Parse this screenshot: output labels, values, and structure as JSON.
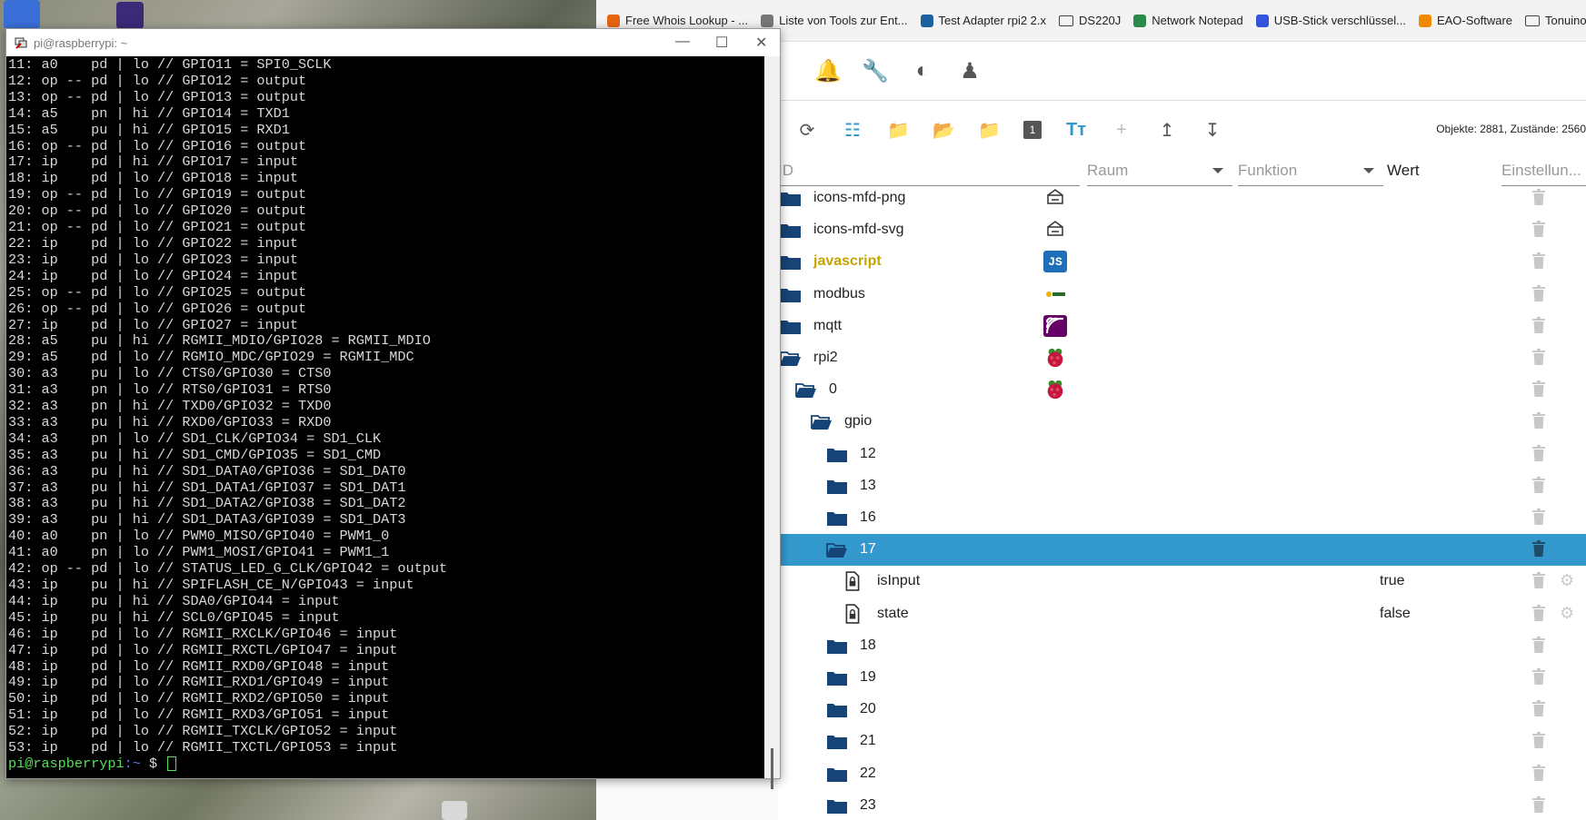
{
  "browser": {
    "bookmarks": [
      {
        "label": "Free Whois Lookup - ...",
        "icon": "orange-logo-icon"
      },
      {
        "label": "Liste von Tools zur Ent...",
        "icon": "globe-icon"
      },
      {
        "label": "Test Adapter rpi2 2.x",
        "icon": "iobroker-icon"
      },
      {
        "label": "DS220J",
        "icon": "folder-icon"
      },
      {
        "label": "Network Notepad",
        "icon": "network-icon"
      },
      {
        "label": "USB-Stick verschlüssel...",
        "icon": "arc-icon"
      },
      {
        "label": "EAO-Software",
        "icon": "star-icon"
      },
      {
        "label": "Tonuino",
        "icon": "folder-icon"
      }
    ]
  },
  "admin": {
    "stats": "Objekte: 2881, Zustände: 2560",
    "columns": {
      "id": "ID",
      "raum": "Raum",
      "funktion": "Funktion",
      "wert": "Wert",
      "einstellung": "Einstellun..."
    },
    "rows": [
      {
        "name": "icons-mfd-png",
        "indent": 0,
        "kind": "folder",
        "open": false,
        "icon": "mfd-png-icon"
      },
      {
        "name": "icons-mfd-svg",
        "indent": 0,
        "kind": "folder",
        "open": false,
        "icon": "mfd-svg-icon"
      },
      {
        "name": "javascript",
        "indent": 0,
        "kind": "folder",
        "open": false,
        "icon": "js-icon",
        "highlight": true
      },
      {
        "name": "modbus",
        "indent": 0,
        "kind": "folder",
        "open": false,
        "icon": "modbus-icon"
      },
      {
        "name": "mqtt",
        "indent": 0,
        "kind": "folder",
        "open": false,
        "icon": "mqtt-icon"
      },
      {
        "name": "rpi2",
        "indent": 0,
        "kind": "folder",
        "open": true,
        "icon": "raspberry-icon"
      },
      {
        "name": "0",
        "indent": 1,
        "kind": "folder",
        "open": true,
        "icon": "raspberry-icon"
      },
      {
        "name": "gpio",
        "indent": 2,
        "kind": "folder",
        "open": true
      },
      {
        "name": "12",
        "indent": 3,
        "kind": "folder",
        "open": false
      },
      {
        "name": "13",
        "indent": 3,
        "kind": "folder",
        "open": false
      },
      {
        "name": "16",
        "indent": 3,
        "kind": "folder",
        "open": false
      },
      {
        "name": "17",
        "indent": 3,
        "kind": "folder",
        "open": true,
        "selected": true
      },
      {
        "name": "isInput",
        "indent": 4,
        "kind": "state",
        "value": "true"
      },
      {
        "name": "state",
        "indent": 4,
        "kind": "state",
        "value": "false"
      },
      {
        "name": "18",
        "indent": 3,
        "kind": "folder",
        "open": false
      },
      {
        "name": "19",
        "indent": 3,
        "kind": "folder",
        "open": false
      },
      {
        "name": "20",
        "indent": 3,
        "kind": "folder",
        "open": false
      },
      {
        "name": "21",
        "indent": 3,
        "kind": "folder",
        "open": false
      },
      {
        "name": "22",
        "indent": 3,
        "kind": "folder",
        "open": false
      },
      {
        "name": "23",
        "indent": 3,
        "kind": "folder",
        "open": false
      }
    ]
  },
  "terminal": {
    "title": "pi@raspberrypi: ~",
    "lines": [
      "11: a0    pd | lo // GPIO11 = SPI0_SCLK",
      "12: op -- pd | lo // GPIO12 = output",
      "13: op -- pd | lo // GPIO13 = output",
      "14: a5    pn | hi // GPIO14 = TXD1",
      "15: a5    pu | hi // GPIO15 = RXD1",
      "16: op -- pd | lo // GPIO16 = output",
      "17: ip    pd | hi // GPIO17 = input",
      "18: ip    pd | lo // GPIO18 = input",
      "19: op -- pd | lo // GPIO19 = output",
      "20: op -- pd | lo // GPIO20 = output",
      "21: op -- pd | lo // GPIO21 = output",
      "22: ip    pd | lo // GPIO22 = input",
      "23: ip    pd | lo // GPIO23 = input",
      "24: ip    pd | lo // GPIO24 = input",
      "25: op -- pd | lo // GPIO25 = output",
      "26: op -- pd | lo // GPIO26 = output",
      "27: ip    pd | lo // GPIO27 = input",
      "28: a5    pu | hi // RGMII_MDIO/GPIO28 = RGMII_MDIO",
      "29: a5    pd | lo // RGMIO_MDC/GPIO29 = RGMII_MDC",
      "30: a3    pu | lo // CTS0/GPIO30 = CTS0",
      "31: a3    pn | lo // RTS0/GPIO31 = RTS0",
      "32: a3    pn | hi // TXD0/GPIO32 = TXD0",
      "33: a3    pu | hi // RXD0/GPIO33 = RXD0",
      "34: a3    pn | lo // SD1_CLK/GPIO34 = SD1_CLK",
      "35: a3    pu | hi // SD1_CMD/GPIO35 = SD1_CMD",
      "36: a3    pu | hi // SD1_DATA0/GPIO36 = SD1_DAT0",
      "37: a3    pu | hi // SD1_DATA1/GPIO37 = SD1_DAT1",
      "38: a3    pu | hi // SD1_DATA2/GPIO38 = SD1_DAT2",
      "39: a3    pu | hi // SD1_DATA3/GPIO39 = SD1_DAT3",
      "40: a0    pn | lo // PWM0_MISO/GPIO40 = PWM1_0",
      "41: a0    pn | lo // PWM1_MOSI/GPIO41 = PWM1_1",
      "42: op -- pd | lo // STATUS_LED_G_CLK/GPIO42 = output",
      "43: ip    pu | hi // SPIFLASH_CE_N/GPIO43 = input",
      "44: ip    pu | hi // SDA0/GPIO44 = input",
      "45: ip    pu | hi // SCL0/GPIO45 = input",
      "46: ip    pd | lo // RGMII_RXCLK/GPIO46 = input",
      "47: ip    pd | lo // RGMII_RXCTL/GPIO47 = input",
      "48: ip    pd | lo // RGMII_RXD0/GPIO48 = input",
      "49: ip    pd | lo // RGMII_RXD1/GPIO49 = input",
      "50: ip    pd | lo // RGMII_RXD2/GPIO50 = input",
      "51: ip    pd | lo // RGMII_RXD3/GPIO51 = input",
      "52: ip    pd | lo // RGMII_TXCLK/GPIO52 = input",
      "53: ip    pd | lo // RGMII_TXCTL/GPIO53 = input"
    ],
    "prompt_user": "pi@raspberrypi",
    "prompt_path": ":~",
    "prompt_symbol": " $ "
  },
  "colors": {
    "accent": "#3399cc",
    "folder": "#164477",
    "terminal_bg": "#000000",
    "terminal_fg": "#d8d8d8",
    "prompt_green": "#55e055",
    "prompt_blue": "#5577ff",
    "js_yellow": "#c7a300"
  }
}
